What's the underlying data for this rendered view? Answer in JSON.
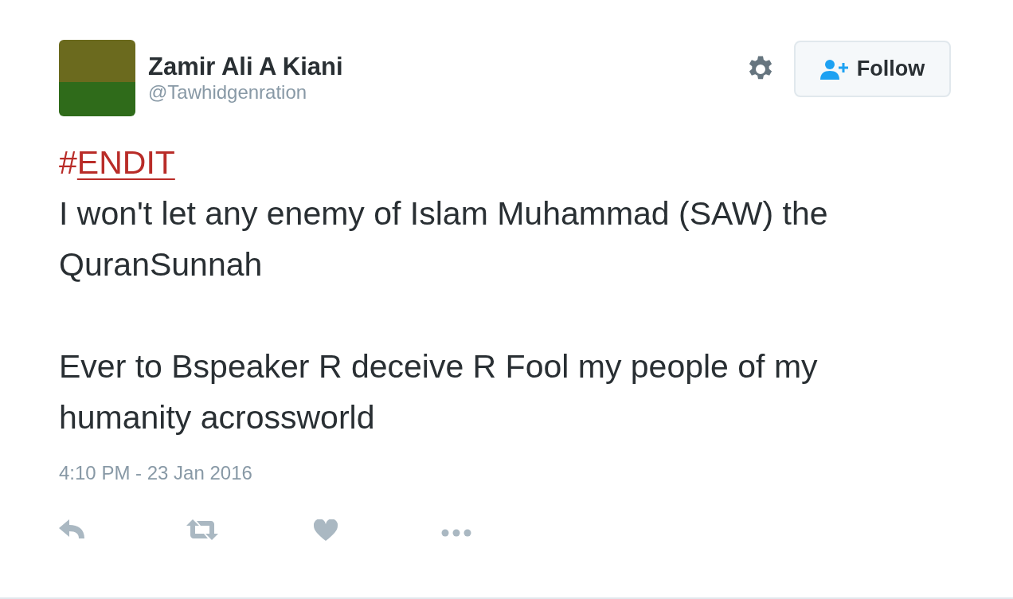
{
  "author": {
    "name": "Zamir Ali A Kiani",
    "handle": "@Tawhidgenration"
  },
  "follow_button": {
    "label": "Follow"
  },
  "tweet": {
    "hashtag_prefix": "#",
    "hashtag": "ENDIT",
    "paragraphs": [
      "I won't let any enemy of Islam Muhammad (SAW) the QuranSunnah",
      "Ever to Bspeaker R deceive R Fool my people of my humanity acrossworld"
    ]
  },
  "timestamp": "4:10 PM - 23 Jan 2016"
}
